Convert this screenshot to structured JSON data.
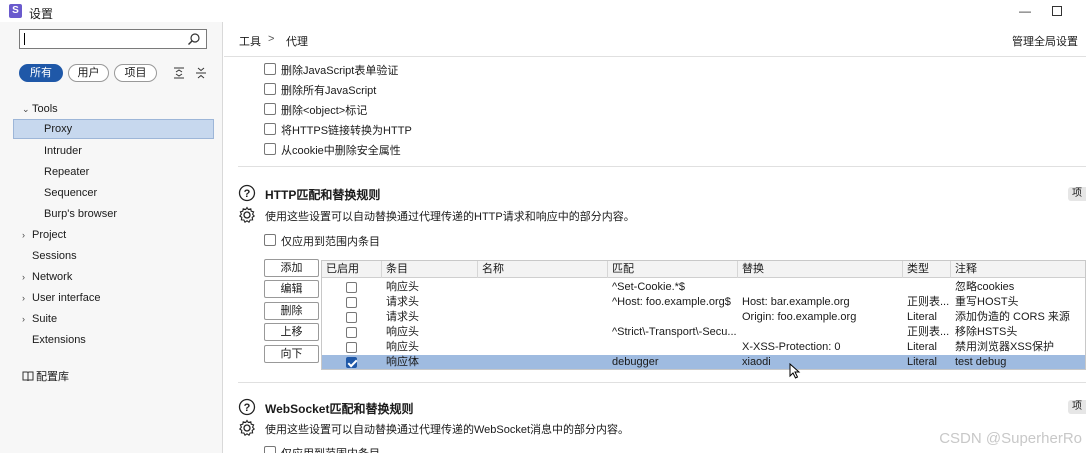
{
  "window": {
    "title": "设置"
  },
  "sidebar": {
    "search": {
      "value": "",
      "placeholder": ""
    },
    "filters": [
      "所有",
      "用户",
      "项目"
    ],
    "tree": {
      "tools": "Tools",
      "proxy": "Proxy",
      "intruder": "Intruder",
      "repeater": "Repeater",
      "sequencer": "Sequencer",
      "burps_browser": "Burp's browser",
      "project": "Project",
      "sessions": "Sessions",
      "network": "Network",
      "user_interface": "User interface",
      "suite": "Suite",
      "extensions": "Extensions"
    },
    "config_library": "配置库"
  },
  "header": {
    "breadcrumb": [
      "工具",
      "代理"
    ],
    "separator": ">",
    "global_settings": "管理全局设置"
  },
  "options": [
    {
      "label": "删除JavaScript表单验证",
      "checked": false
    },
    {
      "label": "删除所有JavaScript",
      "checked": false
    },
    {
      "label": "删除<object>标记",
      "checked": false
    },
    {
      "label": "将HTTPS链接转换为HTTP",
      "checked": false
    },
    {
      "label": "从cookie中删除安全属性",
      "checked": false
    }
  ],
  "http_rules": {
    "title": "HTTP匹配和替换规则",
    "desc": "使用这些设置可以自动替换通过代理传递的HTTP请求和响应中的部分内容。",
    "scope_label": "仅应用到范围内条目",
    "side_label": "项",
    "buttons": [
      "添加",
      "编辑",
      "删除",
      "上移",
      "向下"
    ],
    "columns": [
      "已启用",
      "条目",
      "名称",
      "匹配",
      "替换",
      "类型",
      "注释"
    ],
    "rows": [
      {
        "enabled": false,
        "item": "响应头",
        "name": "",
        "match": "^Set-Cookie.*$",
        "replace": "",
        "type": "",
        "comment": "忽略cookies"
      },
      {
        "enabled": false,
        "item": "请求头",
        "name": "",
        "match": "^Host: foo.example.org$",
        "replace": "Host: bar.example.org",
        "type": "正则表...",
        "comment": "重写HOST头"
      },
      {
        "enabled": false,
        "item": "请求头",
        "name": "",
        "match": "",
        "replace": "Origin: foo.example.org",
        "type": "Literal",
        "comment": "添加伪造的 CORS 来源"
      },
      {
        "enabled": false,
        "item": "响应头",
        "name": "",
        "match": "^Strict\\-Transport\\-Secu...",
        "replace": "",
        "type": "正则表...",
        "comment": "移除HSTS头"
      },
      {
        "enabled": false,
        "item": "响应头",
        "name": "",
        "match": "",
        "replace": "X-XSS-Protection: 0",
        "type": "Literal",
        "comment": "禁用浏览器XSS保护"
      },
      {
        "enabled": true,
        "item": "响应体",
        "name": "",
        "match": "debugger",
        "replace": "xiaodi",
        "type": "Literal",
        "comment": "test debug"
      }
    ]
  },
  "ws_rules": {
    "title": "WebSocket匹配和替换规则",
    "desc": "使用这些设置可以自动替换通过代理传递的WebSocket消息中的部分内容。",
    "scope_label": "仅应用到范围内条目",
    "side_label": "项"
  },
  "watermark": "CSDN @SuperherRo",
  "colors": {
    "accent": "#1f58a8",
    "selection": "#9fbbe0",
    "sidebar_selected": "#c7d8ee"
  }
}
